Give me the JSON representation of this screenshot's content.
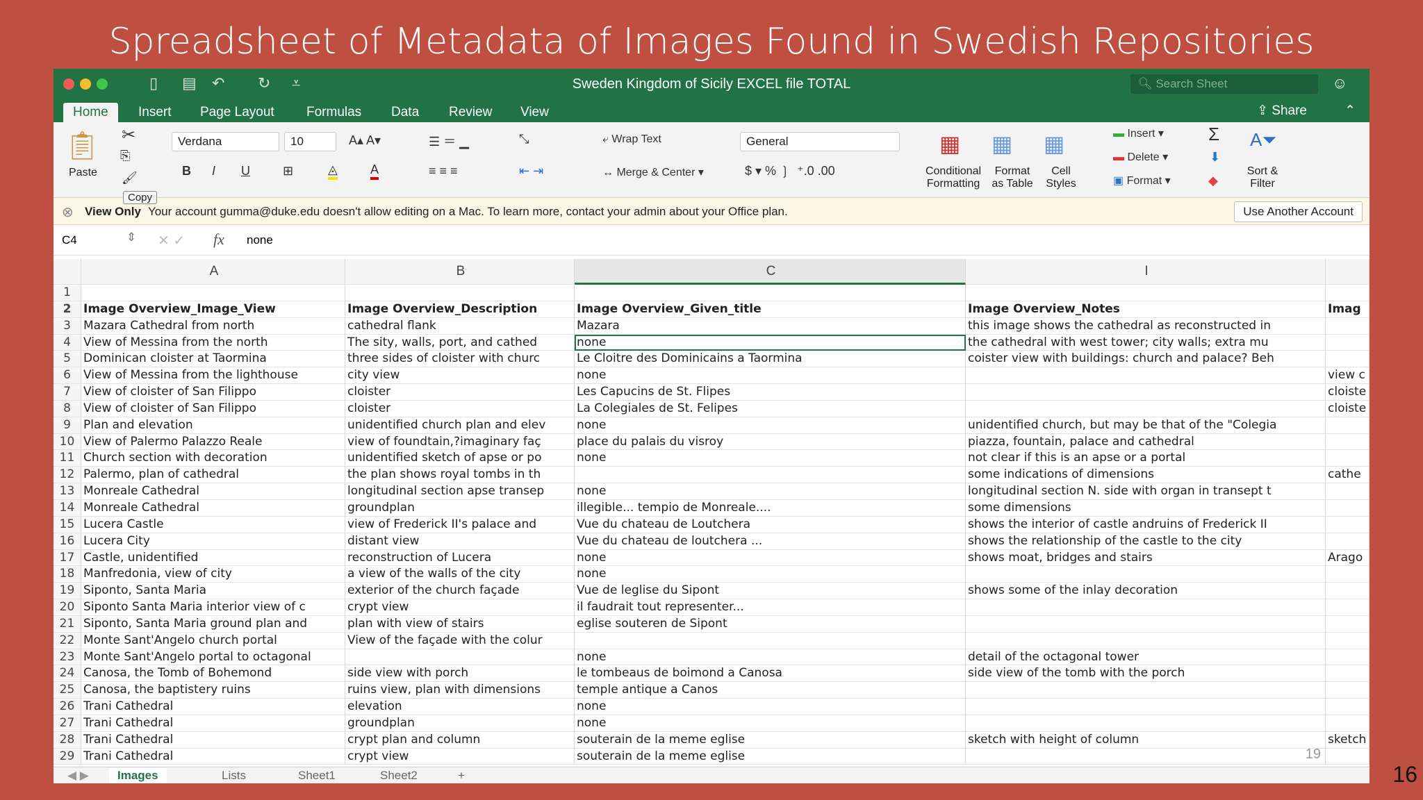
{
  "slide": {
    "title": "Spreadsheet of Metadata of Images Found in Swedish Repositories",
    "page_number": "16",
    "inner_page_number": "19"
  },
  "window": {
    "title": "Sweden Kingdom of Sicily EXCEL file TOTAL",
    "search_placeholder": "Search Sheet"
  },
  "tabs": [
    "Home",
    "Insert",
    "Page Layout",
    "Formulas",
    "Data",
    "Review",
    "View"
  ],
  "share_label": "Share",
  "ribbon": {
    "paste": "Paste",
    "copy_tooltip": "Copy",
    "font": "Verdana",
    "size": "10",
    "wrap_text": "Wrap Text",
    "merge_center": "Merge & Center",
    "number_format": "General",
    "conditional_formatting": "Conditional Formatting",
    "format_as_table": "Format as Table",
    "cell_styles": "Cell Styles",
    "insert": "Insert",
    "delete": "Delete",
    "format": "Format",
    "sort_filter": "Sort & Filter"
  },
  "infobar": {
    "label": "View Only",
    "message": "Your account gumma@duke.edu doesn't allow editing on a Mac. To learn more, contact your admin about your Office plan.",
    "button": "Use Another Account"
  },
  "formula_bar": {
    "name_box": "C4",
    "value": "none"
  },
  "columns": [
    "A",
    "B",
    "C",
    "I",
    ""
  ],
  "rows": [
    [
      "1",
      "",
      "",
      "",
      "",
      ""
    ],
    [
      "2",
      "Image Overview_Image_View",
      "Image Overview_Description",
      "Image Overview_Given_title",
      "Image Overview_Notes",
      "Imag"
    ],
    [
      "3",
      "Mazara Cathedral from north",
      "cathedral flank",
      "Mazara",
      "this image shows the cathedral as reconstructed in",
      ""
    ],
    [
      "4",
      "View of Messina from the north",
      "The sity, walls, port, and cathed",
      "none",
      "the cathedral with west tower; city walls; extra mu",
      ""
    ],
    [
      "5",
      "Dominican cloister at Taormina",
      "three sides of cloister with churc",
      "Le Cloitre des Dominicains a Taormina",
      "coister view with buildings: church and palace? Beh",
      ""
    ],
    [
      "6",
      "View of Messina from the lighthouse",
      "city view",
      "none",
      "",
      "view c"
    ],
    [
      "7",
      "View of cloister of San Filippo",
      "cloister",
      "Les Capucins de St. Flipes",
      "",
      "cloiste"
    ],
    [
      "8",
      "View of cloister of San Filippo",
      "cloister",
      "La Colegiales de St. Felipes",
      "",
      "cloiste"
    ],
    [
      "9",
      "Plan and elevation",
      "unidentified church plan and elev",
      "none",
      "unidentified church, but may be that of the \"Colegia",
      ""
    ],
    [
      "10",
      "View of Palermo Palazzo Reale",
      "view of foundtain,?imaginary faç",
      "place du palais du visroy",
      "piazza, fountain, palace and cathedral",
      ""
    ],
    [
      "11",
      "Church section with decoration",
      "unidentified sketch of apse or po",
      "none",
      "not clear if this is an apse or a portal",
      ""
    ],
    [
      "12",
      "Palermo, plan of cathedral",
      "the plan shows royal tombs in th",
      "",
      "some indications of dimensions",
      "cathe"
    ],
    [
      "13",
      "Monreale Cathedral",
      "longitudinal section apse transep",
      "none",
      "longitudinal section N. side with organ in transept t",
      ""
    ],
    [
      "14",
      "Monreale Cathedral",
      "groundplan",
      "illegible... tempio de Monreale....",
      "some dimensions",
      ""
    ],
    [
      "15",
      "Lucera Castle",
      "view of Frederick II's palace and",
      "Vue du chateau de Loutchera",
      "shows the interior of castle andruins of Frederick II",
      ""
    ],
    [
      "16",
      "Lucera City",
      "distant view",
      "Vue du chateau de loutchera ...",
      "shows the relationship of the castle to the city",
      ""
    ],
    [
      "17",
      "Castle, unidentified",
      "reconstruction of Lucera",
      "none",
      "shows moat, bridges and stairs",
      "Arago"
    ],
    [
      "18",
      "Manfredonia, view of city",
      "a view of the walls of the city",
      "none",
      "",
      ""
    ],
    [
      "19",
      "Siponto, Santa Maria",
      "exterior of the church façade",
      "Vue de leglise du Sipont",
      "shows some of the inlay decoration",
      ""
    ],
    [
      "20",
      "Siponto Santa Maria interior view of c",
      "crypt view",
      "il faudrait tout representer...",
      "",
      ""
    ],
    [
      "21",
      "Siponto, Santa Maria ground plan and",
      "plan with view of stairs",
      "eglise souteren de Sipont",
      "",
      ""
    ],
    [
      "22",
      "Monte Sant'Angelo church portal",
      "View of the façade with the colur",
      "",
      "",
      ""
    ],
    [
      "23",
      "Monte Sant'Angelo portal to octagonal",
      "",
      "none",
      "detail of the octagonal tower",
      ""
    ],
    [
      "24",
      "Canosa, the Tomb of Bohemond",
      "side view with porch",
      "le tombeaus de boimond a Canosa",
      "side view of the tomb with the porch",
      ""
    ],
    [
      "25",
      "Canosa, the baptistery ruins",
      "ruins view, plan with dimensions",
      "temple antique a Canos",
      "",
      ""
    ],
    [
      "26",
      "Trani Cathedral",
      "elevation",
      "none",
      "",
      ""
    ],
    [
      "27",
      "Trani Cathedral",
      "groundplan",
      "none",
      "",
      ""
    ],
    [
      "28",
      "Trani Cathedral",
      "crypt plan and column",
      "souterain de la meme eglise",
      "sketch with height of column",
      "sketch"
    ],
    [
      "29",
      "Trani Cathedral",
      "crypt view",
      "souterain de la meme eglise",
      "",
      ""
    ]
  ],
  "sheet_tabs": [
    "Images",
    "Lists",
    "Sheet1",
    "Sheet2",
    "+"
  ]
}
